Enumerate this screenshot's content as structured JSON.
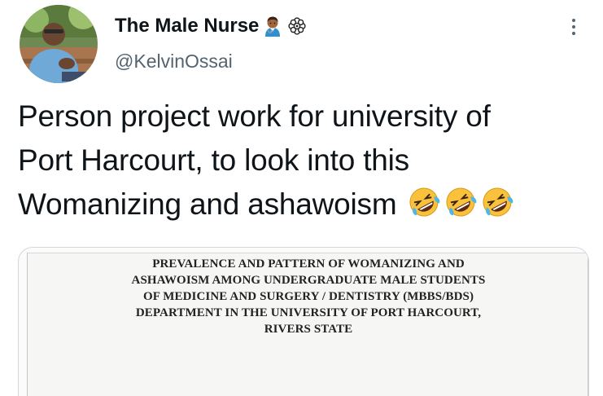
{
  "user": {
    "display_name": "The Male Nurse",
    "handle": "@KelvinOssai",
    "name_emojis": [
      "health-worker-man-emoji",
      "flower-emoji"
    ]
  },
  "tweet": {
    "lines": [
      "Person project work for university of",
      "Port Harcourt, to look into this",
      "Womanizing and ashawoism"
    ],
    "trailing_emojis": [
      "rolling-laughing-emoji",
      "rolling-laughing-emoji",
      "rolling-laughing-emoji"
    ]
  },
  "media": {
    "document_title_lines": [
      "PREVALENCE AND PATTERN OF WOMANIZING AND",
      "ASHAWOISM AMONG UNDERGRADUATE MALE STUDENTS",
      "OF MEDICINE AND SURGERY / DENTISTRY (MBBS/BDS)",
      "DEPARTMENT IN THE UNIVERSITY OF PORT HARCOURT,",
      "RIVERS STATE"
    ]
  },
  "colors": {
    "text_primary": "#0f1419",
    "text_secondary": "#536471",
    "border": "#cfd9de",
    "emoji_yellow": "#f9c13c"
  },
  "icons": {
    "more_menu": "more-icon"
  }
}
